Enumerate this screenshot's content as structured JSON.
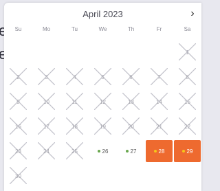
{
  "background_text": [
    "e",
    "e"
  ],
  "calendar": {
    "month_label": "April 2023",
    "next_icon": "chevron-right-icon",
    "weekdays": [
      "Su",
      "Mo",
      "Tu",
      "We",
      "Th",
      "Fr",
      "Sa"
    ],
    "days": [
      {
        "label": "",
        "state": "empty"
      },
      {
        "label": "",
        "state": "empty"
      },
      {
        "label": "",
        "state": "empty"
      },
      {
        "label": "",
        "state": "empty"
      },
      {
        "label": "",
        "state": "empty"
      },
      {
        "label": "",
        "state": "empty"
      },
      {
        "label": "1",
        "state": "unavailable"
      },
      {
        "label": "2",
        "state": "unavailable"
      },
      {
        "label": "3",
        "state": "unavailable"
      },
      {
        "label": "4",
        "state": "unavailable"
      },
      {
        "label": "5",
        "state": "unavailable"
      },
      {
        "label": "6",
        "state": "unavailable"
      },
      {
        "label": "7",
        "state": "unavailable"
      },
      {
        "label": "8",
        "state": "unavailable"
      },
      {
        "label": "9",
        "state": "unavailable"
      },
      {
        "label": "10",
        "state": "unavailable"
      },
      {
        "label": "11",
        "state": "unavailable"
      },
      {
        "label": "12",
        "state": "unavailable"
      },
      {
        "label": "13",
        "state": "unavailable"
      },
      {
        "label": "14",
        "state": "unavailable"
      },
      {
        "label": "15",
        "state": "unavailable"
      },
      {
        "label": "16",
        "state": "unavailable"
      },
      {
        "label": "17",
        "state": "unavailable"
      },
      {
        "label": "18",
        "state": "unavailable"
      },
      {
        "label": "19",
        "state": "unavailable"
      },
      {
        "label": "20",
        "state": "unavailable"
      },
      {
        "label": "21",
        "state": "unavailable"
      },
      {
        "label": "22",
        "state": "unavailable"
      },
      {
        "label": "23",
        "state": "unavailable"
      },
      {
        "label": "24",
        "state": "unavailable"
      },
      {
        "label": "25",
        "state": "unavailable"
      },
      {
        "label": "26",
        "state": "available"
      },
      {
        "label": "27",
        "state": "available"
      },
      {
        "label": "28",
        "state": "selected"
      },
      {
        "label": "29",
        "state": "selected"
      },
      {
        "label": "30",
        "state": "unavailable"
      }
    ]
  },
  "colors": {
    "available_dot": "#6aa84f",
    "selected_bg": "#ee6a2f",
    "selected_dot": "#f5c518",
    "cross_line": "#c4c4cc"
  }
}
